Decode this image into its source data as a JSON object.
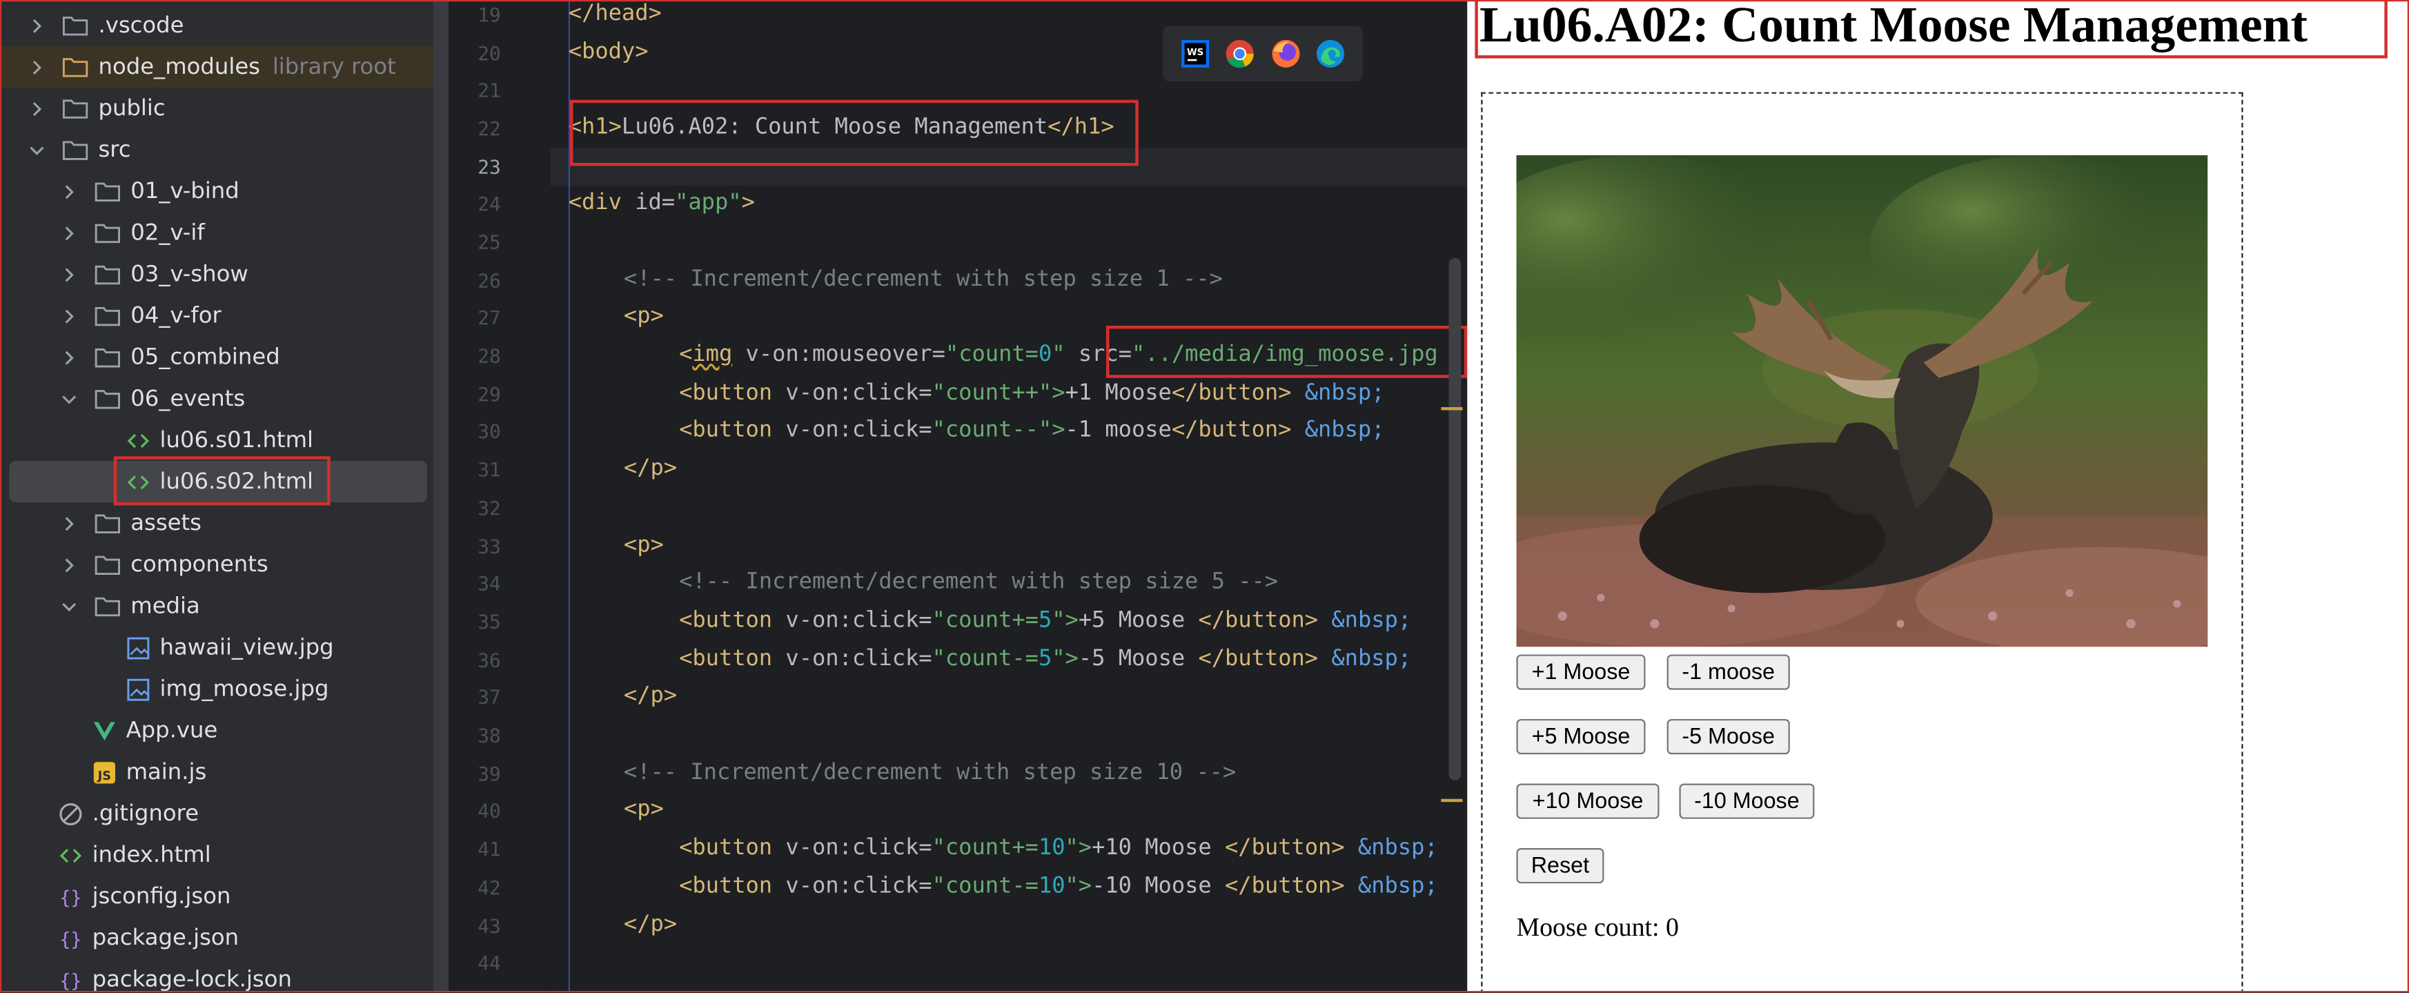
{
  "project_tree": {
    "items": [
      {
        "label": ".vscode"
      },
      {
        "label": "node_modules",
        "note": "library root"
      },
      {
        "label": "public"
      },
      {
        "label": "src"
      },
      {
        "label": "01_v-bind"
      },
      {
        "label": "02_v-if"
      },
      {
        "label": "03_v-show"
      },
      {
        "label": "04_v-for"
      },
      {
        "label": "05_combined"
      },
      {
        "label": "06_events"
      },
      {
        "label": "lu06.s01.html"
      },
      {
        "label": "lu06.s02.html"
      },
      {
        "label": "assets"
      },
      {
        "label": "components"
      },
      {
        "label": "media"
      },
      {
        "label": "hawaii_view.jpg"
      },
      {
        "label": "img_moose.jpg"
      },
      {
        "label": "App.vue"
      },
      {
        "label": "main.js"
      },
      {
        "label": ".gitignore"
      },
      {
        "label": "index.html"
      },
      {
        "label": "jsconfig.json"
      },
      {
        "label": "package.json"
      },
      {
        "label": "package-lock.json"
      }
    ]
  },
  "editor": {
    "line_numbers": [
      "19",
      "20",
      "21",
      "22",
      "23",
      "24",
      "25",
      "26",
      "27",
      "28",
      "29",
      "30",
      "31",
      "32",
      "33",
      "34",
      "35",
      "36",
      "37",
      "38",
      "39",
      "40",
      "41",
      "42",
      "43",
      "44"
    ],
    "current_line": "23",
    "browser_icons": [
      "webstorm-icon",
      "chrome-icon",
      "firefox-icon",
      "edge-icon"
    ],
    "tokens": {
      "head_close": "</head>",
      "body_open": "<body>",
      "h1_open": "<h1>",
      "h1_text": "Lu06.A02: Count Moose Management",
      "h1_close": "</h1>",
      "div_open": "<div",
      "id_attr": " id=",
      "id_value": "\"app\"",
      "gt": ">",
      "comment1": "<!-- Increment/decrement with step size 1 -->",
      "p_open": "<p>",
      "p_close": "</p>",
      "lt": "<",
      "img_tag": "img",
      "von_mouseover": " v-on:mouseover=",
      "q": "\"",
      "count_eq": "count=",
      "zero": "0",
      "src_attr": " src=",
      "src_value": "\"../media/img_moose.jpg",
      "button_open": "<button",
      "button_close": "</button>",
      "von_click": " v-on:click=",
      "count_pp": "count++",
      "count_mm": "count--",
      "count_pe": "count+=",
      "count_me": "count-=",
      "five": "5",
      "ten": "10",
      "gt_q": "\">",
      "plus1": "+1 Moose",
      "minus1": "-1 moose",
      "plus5": "+5 Moose ",
      "minus5": "-5 Moose ",
      "plus10": "+10 Moose ",
      "minus10": "-10 Moose ",
      "nbsp": "&nbsp;",
      "comment5": "<!-- Increment/decrement with step size 5 -->",
      "comment10": "<!-- Increment/decrement with step size 10 -->"
    }
  },
  "preview": {
    "heading": "Lu06.A02: Count Moose Management",
    "buttons": {
      "plus1": "+1 Moose",
      "minus1": "-1 moose",
      "plus5": "+5 Moose",
      "minus5": "-5 Moose",
      "plus10": "+10 Moose",
      "minus10": "-10 Moose",
      "reset": "Reset"
    },
    "count_text": "Moose count: 0"
  },
  "colors": {
    "highlight_box": "#d32f2f",
    "editor_bg": "#1e1f22",
    "tree_bg": "#2b2d30",
    "tag": "#d5b778",
    "string": "#6aab73",
    "number": "#2aacb8",
    "entity": "#5ea0e5",
    "comment": "#7a7e85"
  }
}
